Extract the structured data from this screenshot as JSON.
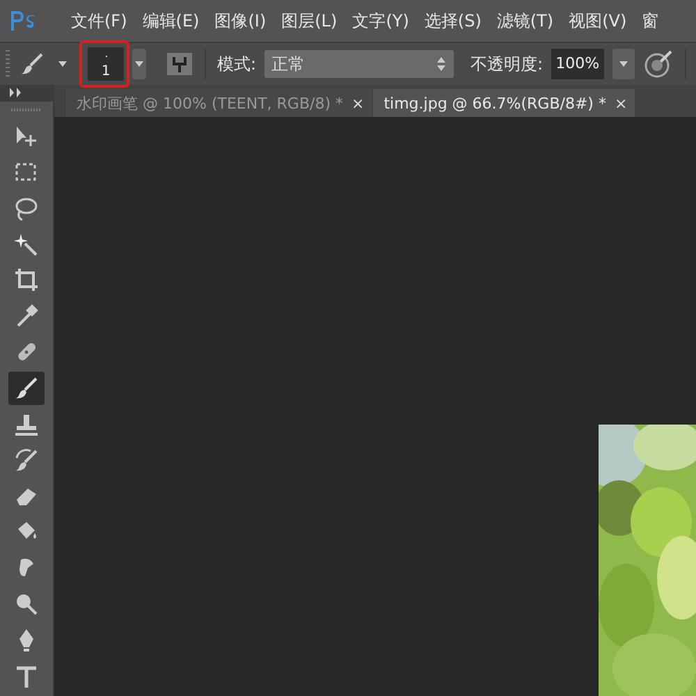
{
  "menu": [
    {
      "label": "文件(F)"
    },
    {
      "label": "编辑(E)"
    },
    {
      "label": "图像(I)"
    },
    {
      "label": "图层(L)"
    },
    {
      "label": "文字(Y)"
    },
    {
      "label": "选择(S)"
    },
    {
      "label": "滤镜(T)"
    },
    {
      "label": "视图(V)"
    },
    {
      "label": "窗"
    }
  ],
  "options_bar": {
    "brush_size": "1",
    "mode_label": "模式:",
    "mode_value": "正常",
    "opacity_label": "不透明度:",
    "opacity_value": "100%"
  },
  "tabs": [
    {
      "label": "水印画笔 @ 100% (TEENT, RGB/8) *",
      "close": "×",
      "selected": false
    },
    {
      "label": "timg.jpg @ 66.7%(RGB/8#) *",
      "close": "×",
      "selected": true
    }
  ],
  "tools": [
    {
      "kind": "move",
      "selected": false
    },
    {
      "kind": "marquee",
      "selected": false
    },
    {
      "kind": "lasso",
      "selected": false
    },
    {
      "kind": "wand",
      "selected": false
    },
    {
      "kind": "crop",
      "selected": false
    },
    {
      "kind": "eyedropper",
      "selected": false
    },
    {
      "kind": "heal",
      "selected": false
    },
    {
      "kind": "brush",
      "selected": true
    },
    {
      "kind": "stamp",
      "selected": false
    },
    {
      "kind": "history",
      "selected": false
    },
    {
      "kind": "eraser",
      "selected": false
    },
    {
      "kind": "bucket",
      "selected": false
    },
    {
      "kind": "smudge",
      "selected": false
    },
    {
      "kind": "dodge",
      "selected": false
    },
    {
      "kind": "pen",
      "selected": false
    },
    {
      "kind": "type",
      "selected": false
    }
  ]
}
